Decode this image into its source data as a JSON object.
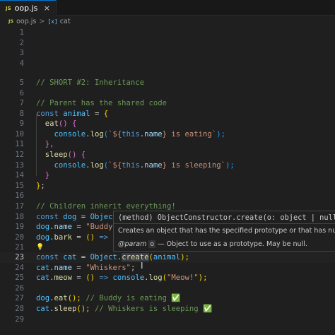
{
  "tab": {
    "icon": "JS",
    "label": "oop.js",
    "close": "×"
  },
  "breadcrumb": {
    "icon": "JS",
    "file": "oop.js",
    "sep": ">",
    "symbol_icon": "[x]",
    "symbol": "cat"
  },
  "lines": {
    "n1": "1",
    "n2": "2",
    "n3": "3",
    "n4": "4",
    "n5": "5",
    "n6": "6",
    "n7": "7",
    "n8": "8",
    "n9": "9",
    "n10": "10",
    "n11": "11",
    "n12": "12",
    "n13": "13",
    "n14": "14",
    "n15": "15",
    "n16": "16",
    "n17": "17",
    "n18": "18",
    "n19": "19",
    "n20": "20",
    "n21": "21",
    "n22": "22",
    "n23": "23",
    "n24": "24",
    "n25": "25",
    "n26": "26",
    "n27": "27",
    "n28": "28",
    "n29": "29"
  },
  "code": {
    "l5": "// SHORT #2: Inheritance",
    "l7": "// Parent has the shared code",
    "l8_kw": "const",
    "l8_var": "animal",
    "l8_eq": " = ",
    "l8_br": "{",
    "l9_fn": "eat",
    "l9_p": "()",
    "l9_br": " {",
    "l10_obj": "console",
    "l10_dot": ".",
    "l10_fn": "log",
    "l10_o": "(",
    "l10_s1": "`${",
    "l10_this": "this",
    "l10_dot2": ".",
    "l10_prop": "name",
    "l10_s2": "} is eating`",
    "l10_c": ");",
    "l11": "},",
    "l12_fn": "sleep",
    "l12_p": "()",
    "l12_br": " {",
    "l13_obj": "console",
    "l13_dot": ".",
    "l13_fn": "log",
    "l13_o": "(",
    "l13_s1": "`${",
    "l13_this": "this",
    "l13_dot2": ".",
    "l13_prop": "name",
    "l13_s2": "} is sleeping`",
    "l13_c": ");",
    "l14": "}",
    "l15_br": "}",
    "l15_semi": ";",
    "l17": "// Children inherit everything!",
    "l18_kw": "const",
    "l18_var": "dog",
    "l18_eq": " = ",
    "l18_obj": "Object",
    "l19_var": "dog",
    "l19_dot": ".",
    "l19_prop": "name",
    "l19_eq": " = ",
    "l19_str": "\"Buddy\"",
    "l20_var": "dog",
    "l20_dot": ".",
    "l20_prop": "bark",
    "l20_eq": " = ",
    "l20_p": "()",
    "l20_arrow": " =>",
    "l23_kw": "const",
    "l23_var": "cat",
    "l23_eq": " = ",
    "l23_obj": "Object",
    "l23_dot": ".",
    "l23_fn_a": "c",
    "l23_fn_b": "reate",
    "l23_o": "(",
    "l23_arg": "animal",
    "l23_c": ");",
    "l24_var": "cat",
    "l24_dot": ".",
    "l24_prop": "name",
    "l24_eq": " = ",
    "l24_str": "\"Whiskers\"",
    "l24_semi": ";",
    "l25_var": "cat",
    "l25_dot": ".",
    "l25_prop": "meow",
    "l25_eq": " = ",
    "l25_p": "()",
    "l25_arrow": " => ",
    "l25_obj": "console",
    "l25_dot2": ".",
    "l25_fn": "log",
    "l25_o": "(",
    "l25_str": "\"Meow!\"",
    "l25_c": ");",
    "l27_var": "dog",
    "l27_dot": ".",
    "l27_fn": "eat",
    "l27_p": "();",
    "l27_comment": " // Buddy is eating ",
    "l27_check": "✅",
    "l28_var": "cat",
    "l28_dot": ".",
    "l28_fn": "sleep",
    "l28_p": "();",
    "l28_comment": " // Whiskers is sleeping ",
    "l28_check": "✅"
  },
  "hover": {
    "signature": "(method) ObjectConstructor.create(o: object | null): any",
    "description": "Creates an object that has the specified prototype or that has null prototype.",
    "param_tag": "@param",
    "param_name": "o",
    "param_desc": " — Object to use as a prototype. May be null."
  },
  "colors": {
    "accent": "#0078d4",
    "comment": "#6a9955",
    "keyword": "#569cd6",
    "string": "#ce9178",
    "function": "#dcdcaa"
  }
}
